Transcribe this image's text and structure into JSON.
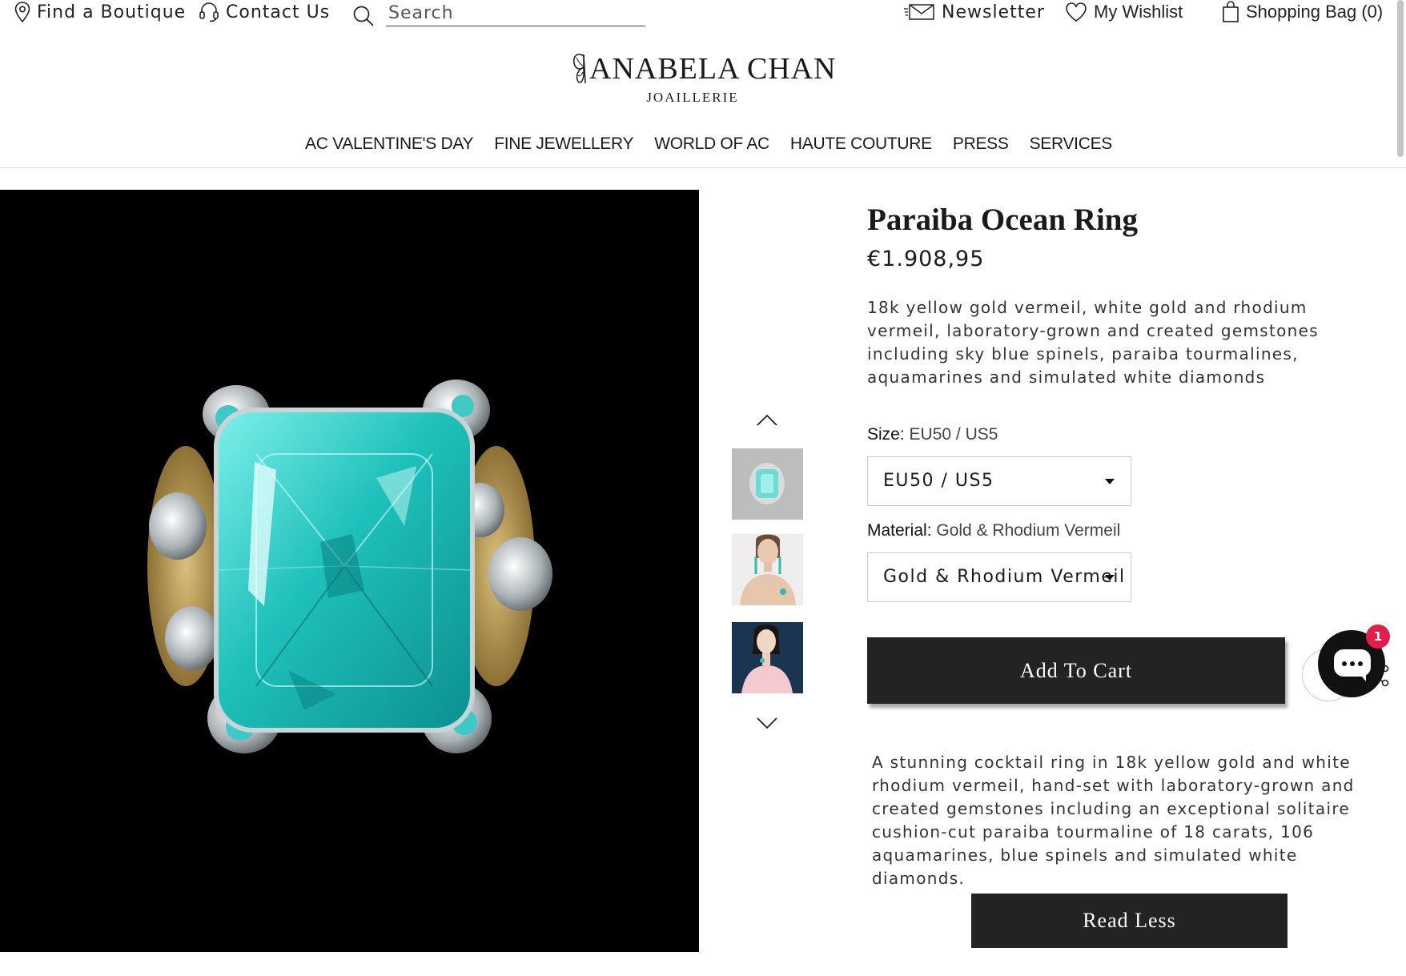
{
  "topbar": {
    "find_boutique": "Find a Boutique",
    "contact_us": "Contact Us",
    "search_placeholder": "Search",
    "newsletter": "Newsletter",
    "wishlist": "My Wishlist",
    "shopping_bag": "Shopping Bag (0)"
  },
  "logo": {
    "name": "ANABELA CHAN",
    "sub": "JOAILLERIE"
  },
  "nav": {
    "items": [
      "AC VALENTINE'S DAY",
      "FINE JEWELLERY",
      "WORLD OF AC",
      "HAUTE COUTURE",
      "PRESS",
      "SERVICES"
    ]
  },
  "product": {
    "title": "Paraiba Ocean Ring",
    "price": "€1.908,95",
    "summary": "18k yellow gold vermeil, white gold and rhodium vermeil, laboratory-grown and created gemstones including sky blue spinels, paraiba tourmalines, aquamarines and simulated white diamonds",
    "size_label": "Size:",
    "size_value": "EU50 / US5",
    "size_selected": "EU50 / US5",
    "material_label": "Material:",
    "material_value": "Gold & Rhodium Vermeil",
    "material_selected": "Gold & Rhodium Vermeil",
    "add_to_cart": "Add To Cart",
    "description": "A stunning cocktail ring in 18k yellow gold and white rhodium vermeil, hand-set with laboratory-grown and created gemstones including an exceptional solitaire cushion-cut paraiba tourmaline of 18 carats, 106 aquamarines, blue spinels and simulated white diamonds.",
    "read_less": "Read Less"
  },
  "chat": {
    "badge_count": "1"
  },
  "colors": {
    "button_bg": "#232323",
    "gem": "#23c4c0",
    "badge": "#e0204a"
  }
}
